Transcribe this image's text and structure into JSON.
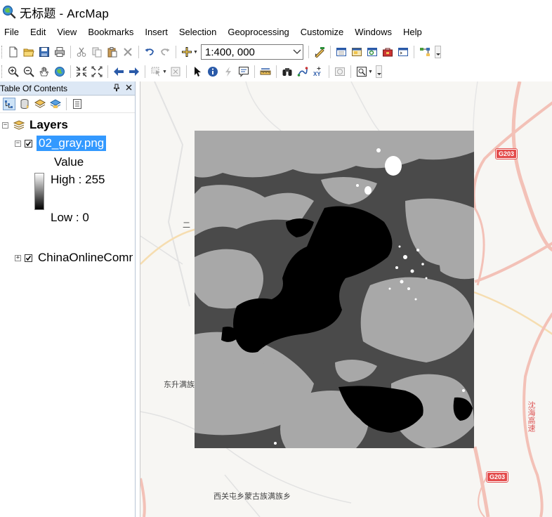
{
  "window": {
    "title": "无标题 - ArcMap"
  },
  "menu": [
    "File",
    "Edit",
    "View",
    "Bookmarks",
    "Insert",
    "Selection",
    "Geoprocessing",
    "Customize",
    "Windows",
    "Help"
  ],
  "toolbar": {
    "scale": "1:400, 000"
  },
  "toc": {
    "title": "Table Of Contents",
    "root_label": "Layers",
    "layers": [
      {
        "name": "02_gray.png",
        "checked": true,
        "expanded": true,
        "selected": true
      },
      {
        "name": "ChinaOnlineCommunity",
        "checked": true,
        "expanded": false,
        "selected": false
      }
    ],
    "legend": {
      "field": "Value",
      "high": "High : 255",
      "low": "Low : 0"
    }
  },
  "map": {
    "labels": {
      "place1": "东升满族",
      "place2": "西关屯乡蒙古族满族乡",
      "road_vertical": "沈海高速",
      "fragment": "二"
    },
    "shields": [
      "G203",
      "G203"
    ]
  },
  "colors": {
    "selection": "#3399ff",
    "panel_header": "#dde8f5",
    "road": "#f2b9b0",
    "road_shield": "#e34b4b"
  }
}
